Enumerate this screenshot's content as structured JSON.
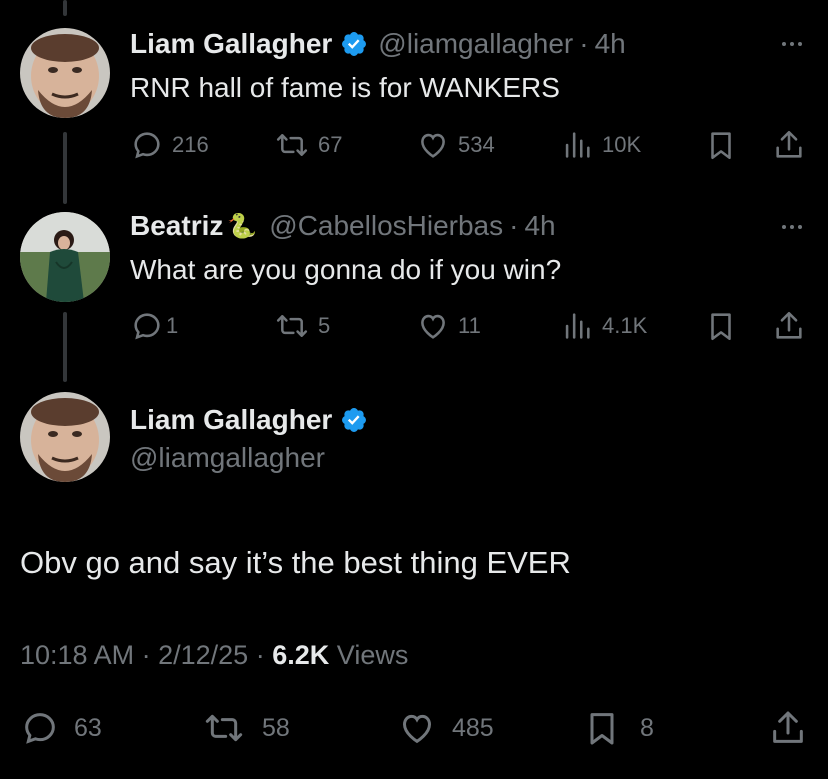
{
  "tweet1": {
    "name": "Liam Gallagher",
    "handle": "@liamgallagher",
    "time": "4h",
    "text": "RNR hall of fame is for WANKERS",
    "replies": "216",
    "retweets": "67",
    "likes": "534",
    "views": "10K"
  },
  "tweet2": {
    "name": "Beatriz",
    "name_emoji": "🐍",
    "handle": "@CabellosHierbas",
    "time": "4h",
    "text": "What are you gonna do if you win?",
    "replies": "1",
    "retweets": "5",
    "likes": "11",
    "views": "4.1K"
  },
  "main": {
    "name": "Liam Gallagher",
    "handle": "@liamgallagher",
    "text": "Obv go and say it’s the best thing EVER",
    "time": "10:18 AM",
    "date": "2/12/25",
    "views_count": "6.2K",
    "views_label": "Views",
    "replies": "63",
    "retweets": "58",
    "likes": "485",
    "bookmarks": "8"
  },
  "separator": "·",
  "colors": {
    "background": "#000000",
    "text_primary": "#e7e9ea",
    "text_secondary": "#71767b",
    "verified": "#1d9bf0"
  },
  "icons": [
    "reply-icon",
    "retweet-icon",
    "like-icon",
    "views-icon",
    "bookmark-icon",
    "share-icon",
    "verified-icon",
    "more-icon"
  ]
}
